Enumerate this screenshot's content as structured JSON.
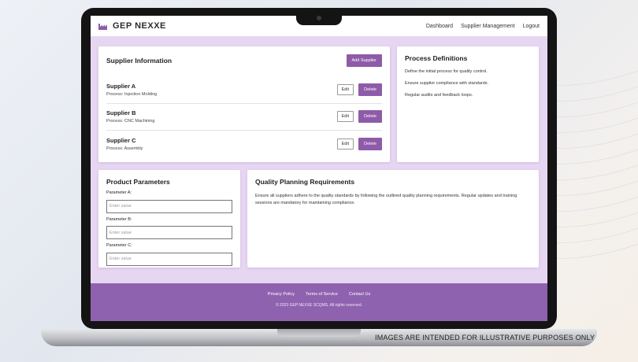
{
  "brand": "GEP NEXXE",
  "nav": [
    "Dashboard",
    "Supplier Management",
    "Logout"
  ],
  "supplier_info": {
    "title": "Supplier Information",
    "add_label": "Add Supplier",
    "suppliers": [
      {
        "name": "Supplier A",
        "process": "Process: Injection Molding"
      },
      {
        "name": "Supplier B",
        "process": "Process: CNC Machining"
      },
      {
        "name": "Supplier C",
        "process": "Process: Assembly"
      }
    ],
    "edit_label": "Edit",
    "delete_label": "Delete"
  },
  "process_definitions": {
    "title": "Process Definitions",
    "items": [
      "Define the initial process for quality control.",
      "Ensure supplier compliance with standards.",
      "Regular audits and feedback loops."
    ]
  },
  "product_parameters": {
    "title": "Product Parameters",
    "params": [
      {
        "label": "Parameter A:",
        "placeholder": "Enter value"
      },
      {
        "label": "Parameter B:",
        "placeholder": "Enter value"
      },
      {
        "label": "Parameter C:",
        "placeholder": "Enter value"
      }
    ]
  },
  "quality_planning": {
    "title": "Quality Planning Requirements",
    "body": "Ensure all suppliers adhere to the quality standards by following the outlined quality planning requirements. Regular updates and training sessions are mandatory for maintaining compliance."
  },
  "footer": {
    "links": [
      "Privacy Policy",
      "Terms of Service",
      "Contact Us"
    ],
    "copyright": "© 2023 GEP NEXXE SCQMS. All rights reserved."
  },
  "disclaimer": "IMAGES ARE INTENDED FOR ILLUSTRATIVE PURPOSES ONLY",
  "colors": {
    "accent": "#8e5ba9",
    "footer": "#8f62b0",
    "screen_bg": "#e6d6f1"
  },
  "icons": {
    "logo": "factory-icon"
  }
}
